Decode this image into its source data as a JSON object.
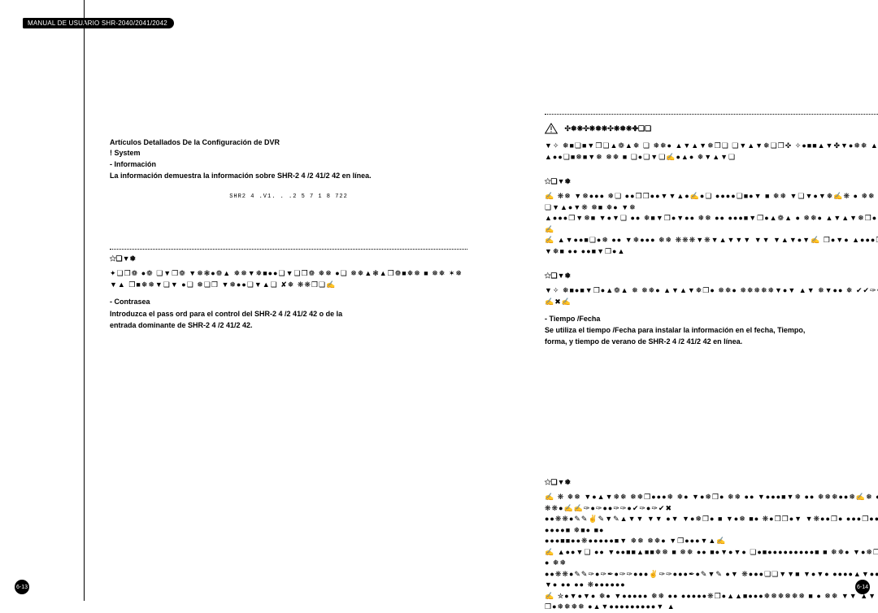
{
  "header": {
    "title": "MANUAL DE USUARIO SHR-2040/2041/2042"
  },
  "left": {
    "section_title": "Artículos Detallados De la Configuración de DVR",
    "system_heading": "! System",
    "info_label": "- Información",
    "info_text": "La información demuestra la información sobre SHR-2 4 /2 41/2 42 en línea.",
    "code_line": "SHR2 4 .V1. . .2  5 7 1 8 722",
    "note_label": "✩❏▼❅",
    "note_garble": "✦❏❒❁ ●❁ ❏▼❒❁ ▼❅❃●❁▲ ❅❅▼❅■●●❏▼❏❒❁ ❅❅ ●❏ ❅❅▲❃▲❒❁■❅❅ ■ ❅❅ ✶❅▼▲ ❒■❅❅▼❏▼ ●❏ ❅❏❒ ▼❅●●❏▼▲❏ ✘❅ ❋❋❒❏✍",
    "contrasea_label": "- Contrasea",
    "contrasea_text1": "Introduzca el pass   ord para el control del SHR-2 4 /2 41/2 42 o de la",
    "contrasea_text2": "entrada dominante de SHR-2 4 /2 41/2 42."
  },
  "right": {
    "warn_label": "✣❅❋✣❋❅❋✣❋❅❋✤❏❏",
    "warn_text": "▼✧ ❅■❏■▼❒❏▲❁▲❅ ❏ ❅❅● ▲▼▲▼❅❒❏ ❏▼▲▼❅❏❒✜ ✧●■■▲▼✤▼●❅❅ ▲❏▲●●❏■❅■▼❅ ❅❅ ■ ❏●❏▼❏✍●▲● ❅▼▲▼❏",
    "note1_label": "✩❏▼❅",
    "note1_l1": "✍ ❋❅ ▼❅●●● ❅❏ ●●❒❒●●▼▼▲●✍●❏ ●●●●❏■●▼ ■ ❅❅ ▼❏▼●▼❅✍❋ ● ❅❅ ▼❏▼▲●▼❋ ❅■ ❅● ▼❅",
    "note1_l2": "▲●●●❒▼❅■ ▼●▼❏ ●● ❅■▼❒●▼●● ❅❅ ●● ●●●■▼❒●▲❁▲ ● ❅❅● ▲▼▲▼❅❒●✍",
    "note1_l3": "✍ ▲▼●●■❏●❅ ●● ▼❅●●● ❅❅ ❋❋❋▼❋▼▲▼▼▼ ▼▼ ▼▲▼●▼✍ ❒●▼● ▲●●●❒▼❅■ ●● ●●■▼❒●▲",
    "note2_label": "✩❏▼❅",
    "note2_text": "▼✧ ❅■●■▼❒●▲❁▲ ❅ ❅❅● ▲▼▲▼❅❒● ❅❅● ❅❅❅❅❅▼●▼ ▲▼ ❅▼●● ❅ ✔✔✑✒✍✖✍",
    "tiempo_label": "- Tiempo /Fecha",
    "tiempo_text1": "Se utiliza el tiempo /Fecha para instalar la información en el fecha, Tiempo,",
    "tiempo_text2": "forma, y tiempo de verano de SHR-2 4 /2 41/2 42 en línea.",
    "note3_label": "✩❏▼❅",
    "note3_l1": "✍ ❋ ❅❅ ▼●▲▼❅❅ ❅❅❒●●●❅ ❅● ▼●❅❒● ❅❅ ●● ▼●●●■▼❅ ●● ❅❅❅●●❅✍❅ ●❋❋●✍✍✑●✑●●✑✑●✔✑●✑✔✖",
    "note3_l2": "●●❋❋●✎✎✌✎▼✎▲▼▼ ▼▼ ●▼ ▼●❅❒● ■ ▼●❅ ■● ❋●❒❒●▼ ▼❋●●❒● ●●●❒●●●●●●●■ ❅■● ■●",
    "note3_l3": "●●●■■●●❋●●●●●■▼ ❅❅ ❅❅● ▼❒●●●▼▲✍",
    "note3_l4": "✍ ▲●●▼❏ ●● ▼●●■■▲■■❅❅ ■ ❅❅ ●● ■●▼●▼● ❏●■●●●●●●●●●■ ■ ❅❅● ▼●❅❒●● ❅❅",
    "note3_l5": "●●❋❋●✎✎✑●✑✒●✑✑●●●✌✑✑●●●✒●✎▼✎ ●▼ ❋●●●❏❏▼▼■ ▼●▼● ●●●●▲▼●●▼● ●● ●● ❋●●●●●●",
    "note3_l6": "✍ ✮●▼●▼● ❅● ▼●●●●● ❅❅ ●● ●●●●●❋❒●▲▲■●●●❅❅❅❅❅❅ ■ ● ❅❅ ▼▼ ▲▼ ❒●❅❅❅❅ ●▲▼●●●●●●●●●▼ ▲"
  },
  "page_numbers": {
    "left": "6-13",
    "right": "6-14"
  }
}
